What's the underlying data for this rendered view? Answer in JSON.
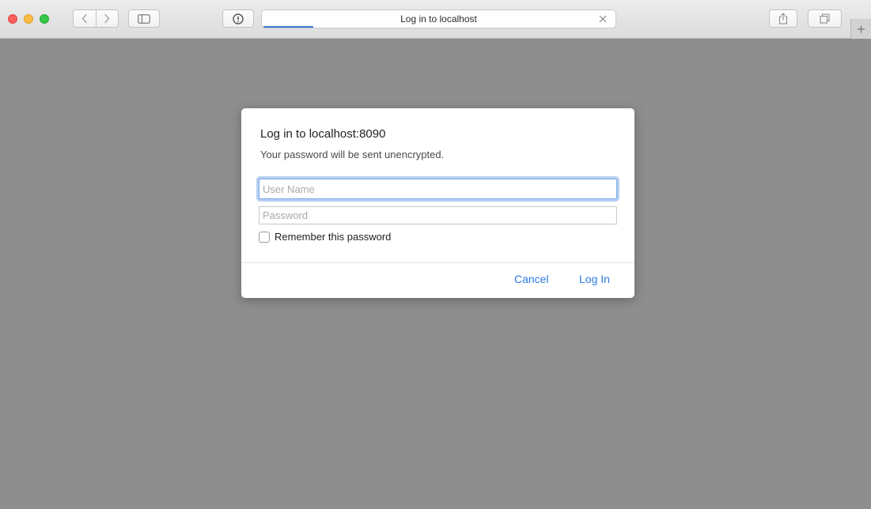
{
  "window": {
    "tab_title": "Log in to localhost",
    "load_progress_percent": 14
  },
  "toolbar": {
    "new_tab_symbol": "+",
    "icons": [
      "back-icon",
      "forward-icon",
      "sidebar-icon",
      "reader-icon",
      "close-icon",
      "share-icon",
      "tabs-icon"
    ]
  },
  "dialog": {
    "title": "Log in to localhost:8090",
    "subtitle": "Your password will be sent unencrypted.",
    "username": {
      "placeholder": "User Name",
      "value": ""
    },
    "password": {
      "placeholder": "Password",
      "value": ""
    },
    "remember_label": "Remember this password",
    "remember_checked": false,
    "cancel_label": "Cancel",
    "login_label": "Log In"
  },
  "colors": {
    "accent": "#2c7be5",
    "background": "#8e8e8e",
    "traffic_red": "#fc605c",
    "traffic_yellow": "#fdbc40",
    "traffic_green": "#34c84a"
  }
}
